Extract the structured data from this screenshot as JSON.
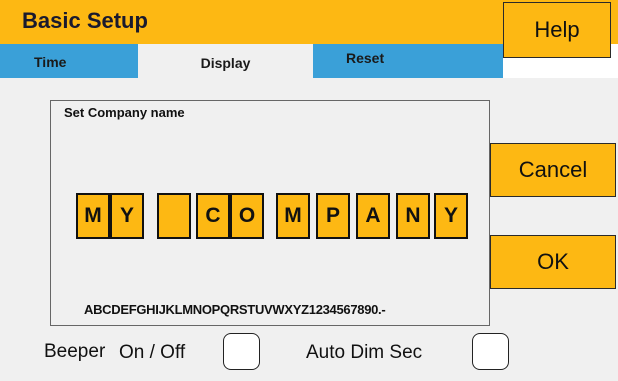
{
  "header": {
    "title": "Basic Setup",
    "help_label": "Help"
  },
  "tabs": [
    {
      "label": "Time"
    },
    {
      "label": "Display"
    },
    {
      "label": "Reset"
    }
  ],
  "panel": {
    "label": "Set Company name",
    "characters": [
      "M",
      "Y",
      "",
      "C",
      "O",
      "M",
      "P",
      "A",
      "N",
      "Y"
    ],
    "alphabet": "ABCDEFGHIJKLMNOPQRSTUVWXYZ1234567890.-"
  },
  "buttons": {
    "cancel": "Cancel",
    "ok": "OK"
  },
  "options": {
    "beeper_label": "Beeper",
    "on_off_label": "On / Off",
    "auto_dim_label": "Auto Dim Sec"
  },
  "colors": {
    "accent": "#fdb813",
    "tab_blue": "#3aa0d8",
    "background": "#f0f0f0"
  }
}
